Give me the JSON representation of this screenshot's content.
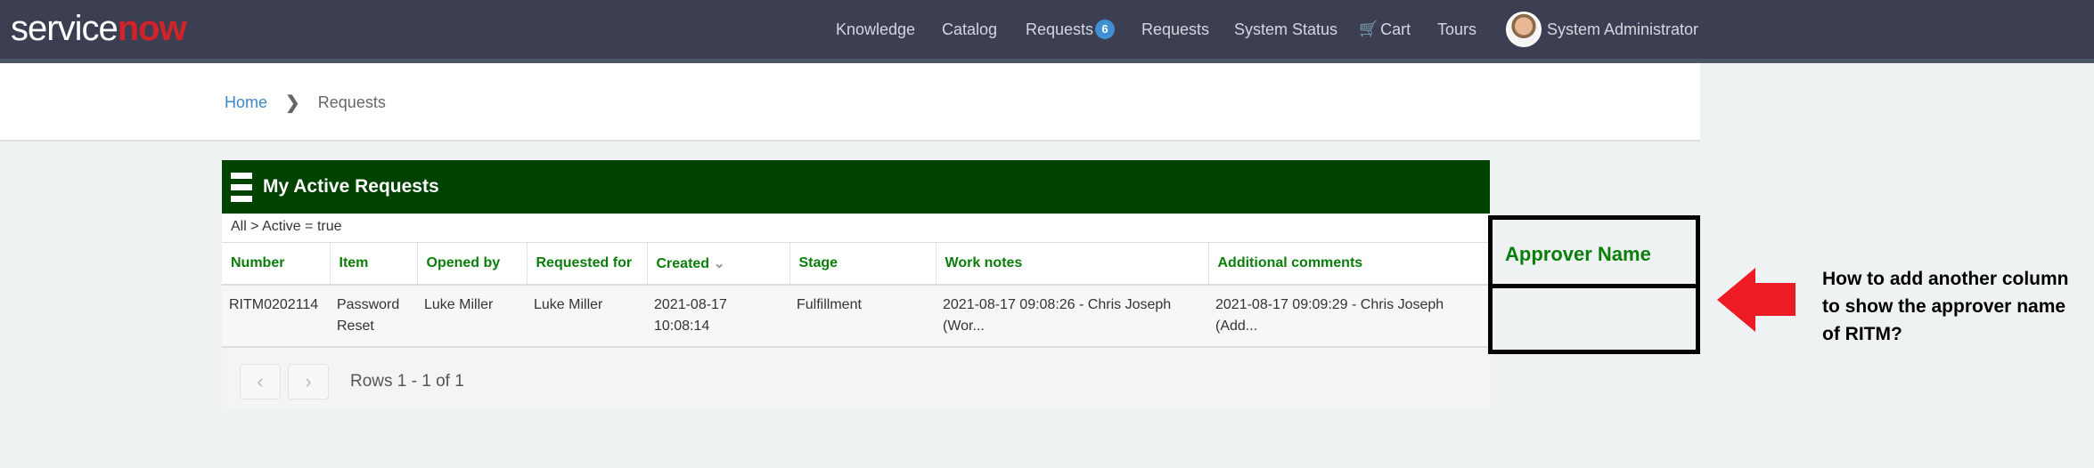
{
  "header": {
    "logo": {
      "service": "service",
      "now": "now"
    },
    "nav": [
      {
        "label": "Knowledge"
      },
      {
        "label": "Catalog"
      },
      {
        "label": "Requests",
        "badge": "6"
      },
      {
        "label": "Requests"
      },
      {
        "label": "System Status"
      },
      {
        "label": "Cart",
        "icon": "cart-icon"
      },
      {
        "label": "Tours"
      }
    ],
    "user": "System Administrator"
  },
  "breadcrumb": {
    "home": "Home",
    "current": "Requests"
  },
  "panel": {
    "title": "My Active Requests",
    "filter": "All > Active = true",
    "columns": [
      "Number",
      "Item",
      "Opened by",
      "Requested for",
      "Created",
      "Stage",
      "Work notes",
      "Additional comments"
    ],
    "rows": [
      {
        "number": "RITM0202114",
        "item": "Password Reset",
        "opened_by": "Luke Miller",
        "requested_for": "Luke Miller",
        "created": "2021-08-17 10:08:14",
        "stage": "Fulfillment",
        "work_notes": "2021-08-17 09:08:26 - Chris Joseph (Wor...",
        "additional_comments": "2021-08-17 09:09:29 - Chris Joseph (Add..."
      }
    ],
    "pagination": "Rows 1 - 1 of 1"
  },
  "annotation": {
    "column_label": "Approver Name",
    "question": "How to add another column to show the approver name of RITM?",
    "arrow_color": "#ed1c24"
  }
}
